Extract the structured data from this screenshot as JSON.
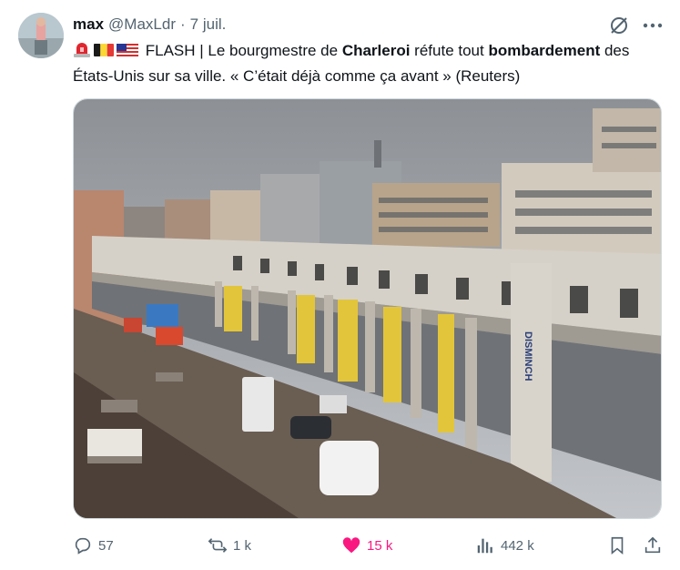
{
  "author": {
    "name": "max",
    "handle": "@MaxLdr",
    "separator": "·",
    "time": "7 juil."
  },
  "tweet": {
    "part1": "FLASH | Le bourgmestre de ",
    "bold1": "Charleroi",
    "part2": " réfute tout ",
    "bold2": "bombardement",
    "part3": " des États-Unis sur sa ville. « C’était déjà comme ça avant » (Reuters)"
  },
  "media": {
    "sign_text": "DISMINCH"
  },
  "actions": {
    "replies": "57",
    "retweets": "1 k",
    "likes": "15 k",
    "views": "442 k"
  },
  "colors": {
    "like": "#f91880",
    "muted": "#536471"
  }
}
